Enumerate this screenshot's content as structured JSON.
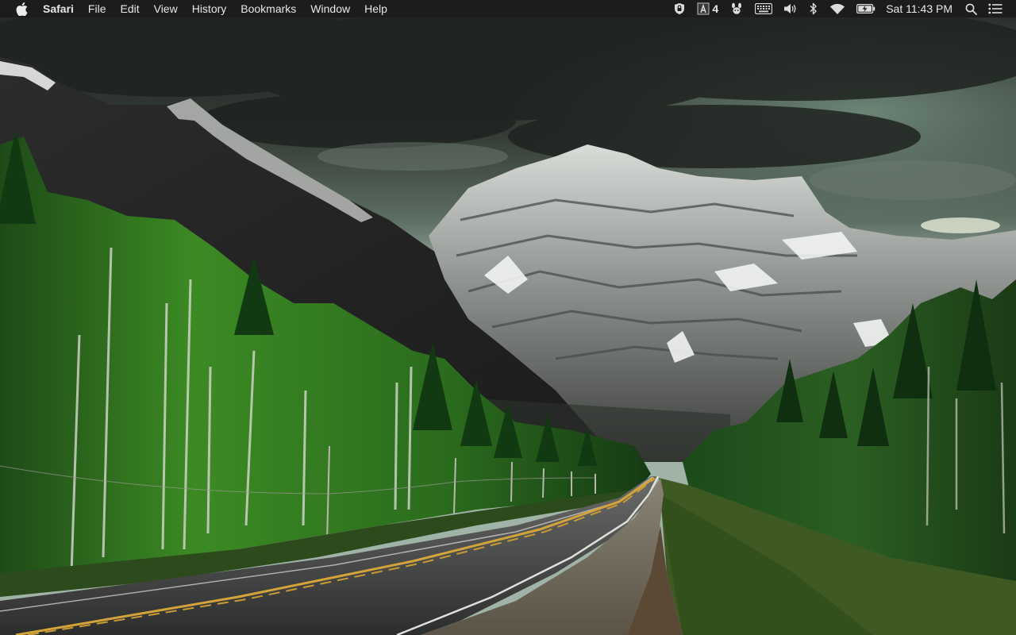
{
  "menubar": {
    "apple_icon": "apple-logo-icon",
    "app_name": "Safari",
    "menus": [
      "File",
      "Edit",
      "View",
      "History",
      "Bookmarks",
      "Window",
      "Help"
    ],
    "status_items": {
      "vpn_icon": "lock-shield-icon",
      "adobe_count": "4",
      "wifi_icon": "wifi-icon",
      "battery_icon": "battery-charging-icon",
      "clock": "Sat 11:43 PM"
    }
  },
  "desktop": {
    "wallpaper": "mountain-road-wallpaper",
    "colors": {
      "sky_dark": "#2b302c",
      "sky_green": "#5f7a6a",
      "mountain_snow": "#e6e9e6",
      "forest": "#2f6b24",
      "road": "#3a3b3b",
      "road_line": "#d4a43a"
    }
  }
}
